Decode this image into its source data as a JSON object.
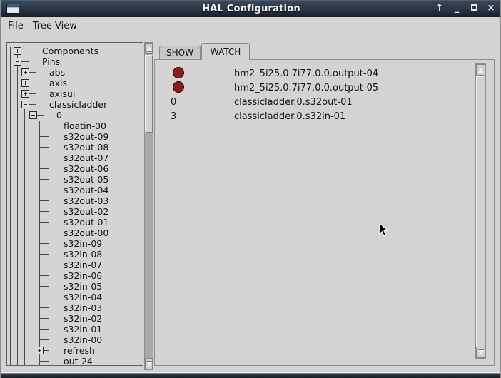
{
  "window": {
    "title": "HAL Configuration",
    "controls": [
      {
        "name": "shade",
        "glyph": "↑"
      },
      {
        "name": "minimize",
        "glyph": "_"
      },
      {
        "name": "maximize",
        "glyph": "□"
      },
      {
        "name": "close",
        "glyph": "×"
      }
    ]
  },
  "menu": {
    "items": [
      {
        "label": "File"
      },
      {
        "label": "Tree View"
      }
    ]
  },
  "tree": {
    "items": [
      {
        "label": "Components",
        "level": 0,
        "expander": "plus"
      },
      {
        "label": "Pins",
        "level": 0,
        "expander": "minus"
      },
      {
        "label": "abs",
        "level": 1,
        "expander": "plus"
      },
      {
        "label": "axis",
        "level": 1,
        "expander": "plus"
      },
      {
        "label": "axisui",
        "level": 1,
        "expander": "plus"
      },
      {
        "label": "classicladder",
        "level": 1,
        "expander": "minus"
      },
      {
        "label": "0",
        "level": 2,
        "expander": "minus"
      },
      {
        "label": "floatin-00",
        "level": 3,
        "expander": null
      },
      {
        "label": "s32out-09",
        "level": 3,
        "expander": null
      },
      {
        "label": "s32out-08",
        "level": 3,
        "expander": null
      },
      {
        "label": "s32out-07",
        "level": 3,
        "expander": null
      },
      {
        "label": "s32out-06",
        "level": 3,
        "expander": null
      },
      {
        "label": "s32out-05",
        "level": 3,
        "expander": null
      },
      {
        "label": "s32out-04",
        "level": 3,
        "expander": null
      },
      {
        "label": "s32out-03",
        "level": 3,
        "expander": null
      },
      {
        "label": "s32out-02",
        "level": 3,
        "expander": null
      },
      {
        "label": "s32out-01",
        "level": 3,
        "expander": null
      },
      {
        "label": "s32out-00",
        "level": 3,
        "expander": null
      },
      {
        "label": "s32in-09",
        "level": 3,
        "expander": null
      },
      {
        "label": "s32in-08",
        "level": 3,
        "expander": null
      },
      {
        "label": "s32in-07",
        "level": 3,
        "expander": null
      },
      {
        "label": "s32in-06",
        "level": 3,
        "expander": null
      },
      {
        "label": "s32in-05",
        "level": 3,
        "expander": null
      },
      {
        "label": "s32in-04",
        "level": 3,
        "expander": null
      },
      {
        "label": "s32in-03",
        "level": 3,
        "expander": null
      },
      {
        "label": "s32in-02",
        "level": 3,
        "expander": null
      },
      {
        "label": "s32in-01",
        "level": 3,
        "expander": null
      },
      {
        "label": "s32in-00",
        "level": 3,
        "expander": null
      },
      {
        "label": "refresh",
        "level": 3,
        "expander": "plus"
      },
      {
        "label": "out-24",
        "level": 3,
        "expander": null
      }
    ]
  },
  "tabs": [
    {
      "label": "SHOW",
      "selected": false
    },
    {
      "label": "WATCH",
      "selected": true
    }
  ],
  "watch": {
    "rows": [
      {
        "indicator": "led",
        "value": "",
        "label": "hm2_5i25.0.7i77.0.0.output-04"
      },
      {
        "indicator": "led",
        "value": "",
        "label": "hm2_5i25.0.7i77.0.0.output-05"
      },
      {
        "indicator": "text",
        "value": "0",
        "label": "classicladder.0.s32out-01"
      },
      {
        "indicator": "text",
        "value": "3",
        "label": "classicladder.0.s32in-01"
      }
    ]
  },
  "colors": {
    "led_off": "#8b1d1d",
    "titlebar_top": "#3a4756",
    "titlebar_bottom": "#161f2b",
    "panel_bg": "#d3d3d3"
  }
}
